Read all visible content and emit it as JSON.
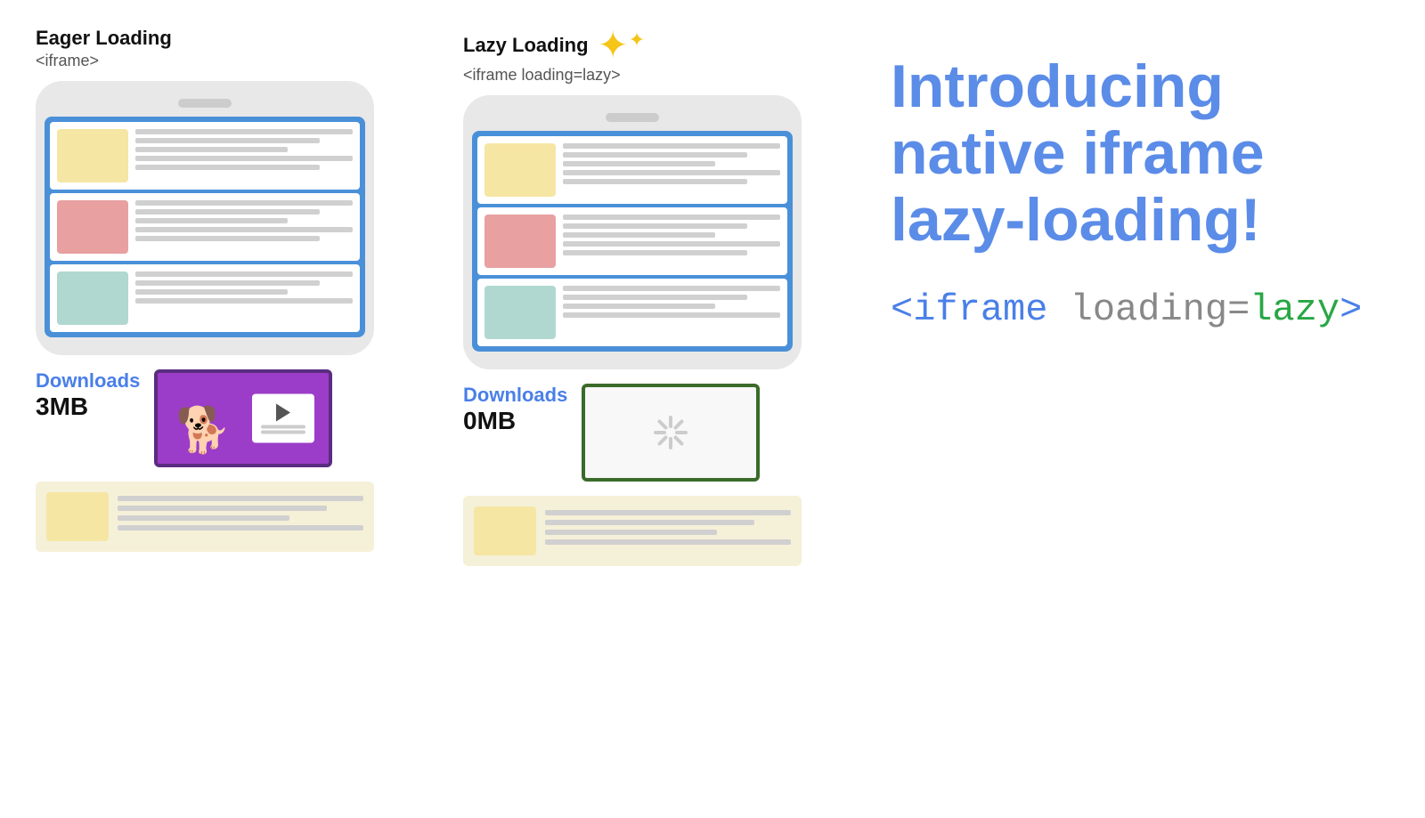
{
  "eager": {
    "title": "Eager Loading",
    "subtitle": "<iframe>",
    "downloads_label": "Downloads",
    "downloads_amount": "3MB"
  },
  "lazy": {
    "title": "Lazy Loading",
    "subtitle": "<iframe loading=lazy>",
    "downloads_label": "Downloads",
    "downloads_amount": "0MB"
  },
  "intro": {
    "heading_line1": "Introducing",
    "heading_line2": "native iframe",
    "heading_line3": "lazy-loading!",
    "code_text": "<iframe loading=lazy>"
  }
}
